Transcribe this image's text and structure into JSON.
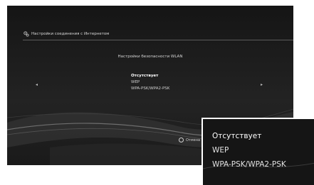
{
  "header": {
    "title": "Настройки соединения с Интернетом"
  },
  "dialog": {
    "title": "Настройки безопасности WLAN"
  },
  "menu": {
    "items": [
      {
        "label": "Отсутствует",
        "selected": true
      },
      {
        "label": "WEP",
        "selected": false
      },
      {
        "label": "WPA-PSK/WPA2-PSK",
        "selected": false
      }
    ]
  },
  "navigation": {
    "left_arrow": "◂",
    "right_arrow": "▸"
  },
  "footer": {
    "back_label": "Отмена"
  },
  "colors": {
    "background": "#1b1b1b",
    "text": "#d4d4d4",
    "selected_text": "#ffffff"
  }
}
